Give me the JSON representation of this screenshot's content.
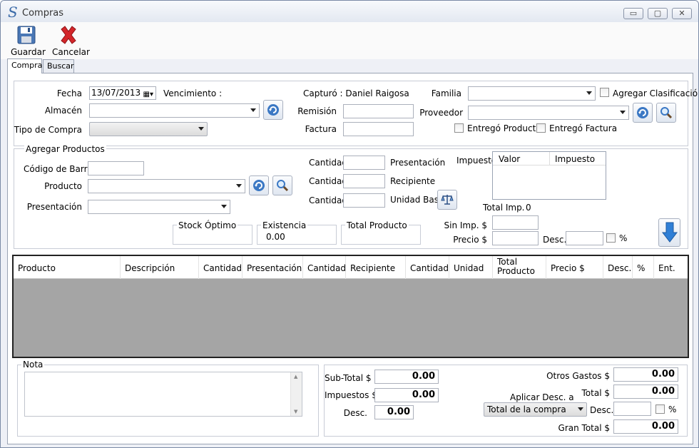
{
  "window": {
    "title": "Compras",
    "app_icon": "S"
  },
  "toolbar": {
    "save_label": "Guardar",
    "cancel_label": "Cancelar"
  },
  "tabs": [
    {
      "label": "Compra"
    },
    {
      "label": "Buscar"
    }
  ],
  "header": {
    "fecha_label": "Fecha",
    "fecha_value": "13/07/2013",
    "vencimiento_label": "Vencimiento :",
    "almacen_label": "Almacén",
    "tipo_compra_label": "Tipo de Compra",
    "capturo_label": "Capturó : Daniel Raigosa",
    "remision_label": "Remisión",
    "factura_label": "Factura",
    "familia_label": "Familia",
    "agregar_clasificacion_label": "Agregar Clasificación",
    "proveedor_label": "Proveedor",
    "entrego_producto_label": "Entregó Producto",
    "entrego_factura_label": "Entregó Factura"
  },
  "agregar": {
    "legend": "Agregar Productos",
    "codigo_label": "Código de Barras",
    "producto_label": "Producto",
    "presentacion_label": "Presentación",
    "cantidad_label": "Cantidad",
    "presentacion_unit": "Presentación",
    "recipiente_unit": "Recipiente",
    "unidad_base_unit": "Unidad Base",
    "impuesto_label": "Impuesto:",
    "impuesto_cols": [
      "Valor",
      "Impuesto"
    ],
    "total_imp_label": "Total Imp.",
    "total_imp_value": "0",
    "stock_optimo_legend": "Stock Óptimo",
    "existencia_legend": "Existencia",
    "existencia_value": "0.00",
    "total_producto_legend": "Total Producto",
    "sin_imp_label": "Sin Imp. $",
    "precio_label": "Precio $",
    "desc_label": "Desc.",
    "pct_label": "%"
  },
  "grid": {
    "columns": [
      "Producto",
      "Descripción",
      "Cantidad",
      "Presentación",
      "Cantidad",
      "Recipiente",
      "Cantidad",
      "Unidad",
      "Total Producto",
      "Precio $",
      "Desc.",
      "%",
      "Ent."
    ]
  },
  "nota": {
    "legend": "Nota"
  },
  "totals": {
    "subtotal_label": "Sub-Total $",
    "subtotal_value": "0.00",
    "impuestos_label": "Impuestos $",
    "impuestos_value": "0.00",
    "desc_label": "Desc.",
    "desc_value": "0.00",
    "otros_gastos_label": "Otros Gastos $",
    "otros_gastos_value": "0.00",
    "total_label": "Total $",
    "total_value": "0.00",
    "aplicar_desc_label": "Aplicar Desc. a",
    "aplicar_desc_selected": "Total de la compra",
    "desc2_label": "Desc.",
    "pct_label": "%",
    "gran_total_label": "Gran Total $",
    "gran_total_value": "0.00"
  },
  "colors": {
    "accent": "#3a6aa8",
    "grid_bg": "#a5a5a5"
  }
}
